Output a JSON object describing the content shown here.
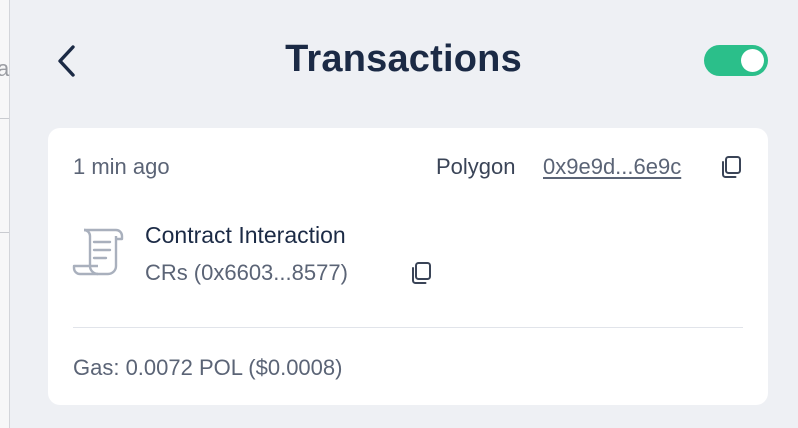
{
  "header": {
    "title": "Transactions",
    "toggle_on": true
  },
  "transaction": {
    "time": "1 min ago",
    "network": "Polygon",
    "tx_hash": "0x9e9d...6e9c",
    "action": "Contract Interaction",
    "contract_name": "CRs",
    "contract_address": "(0x6603...8577)",
    "gas": "Gas: 0.0072 POL ($0.0008)"
  },
  "colors": {
    "background": "#eef0f4",
    "card": "#ffffff",
    "toggle_on": "#2bbf8a",
    "text_primary": "#1b2a45",
    "text_secondary": "#5b6476"
  },
  "icons": {
    "back": "chevron-left-icon",
    "copy": "copy-icon",
    "contract": "receipt-scroll-icon"
  }
}
